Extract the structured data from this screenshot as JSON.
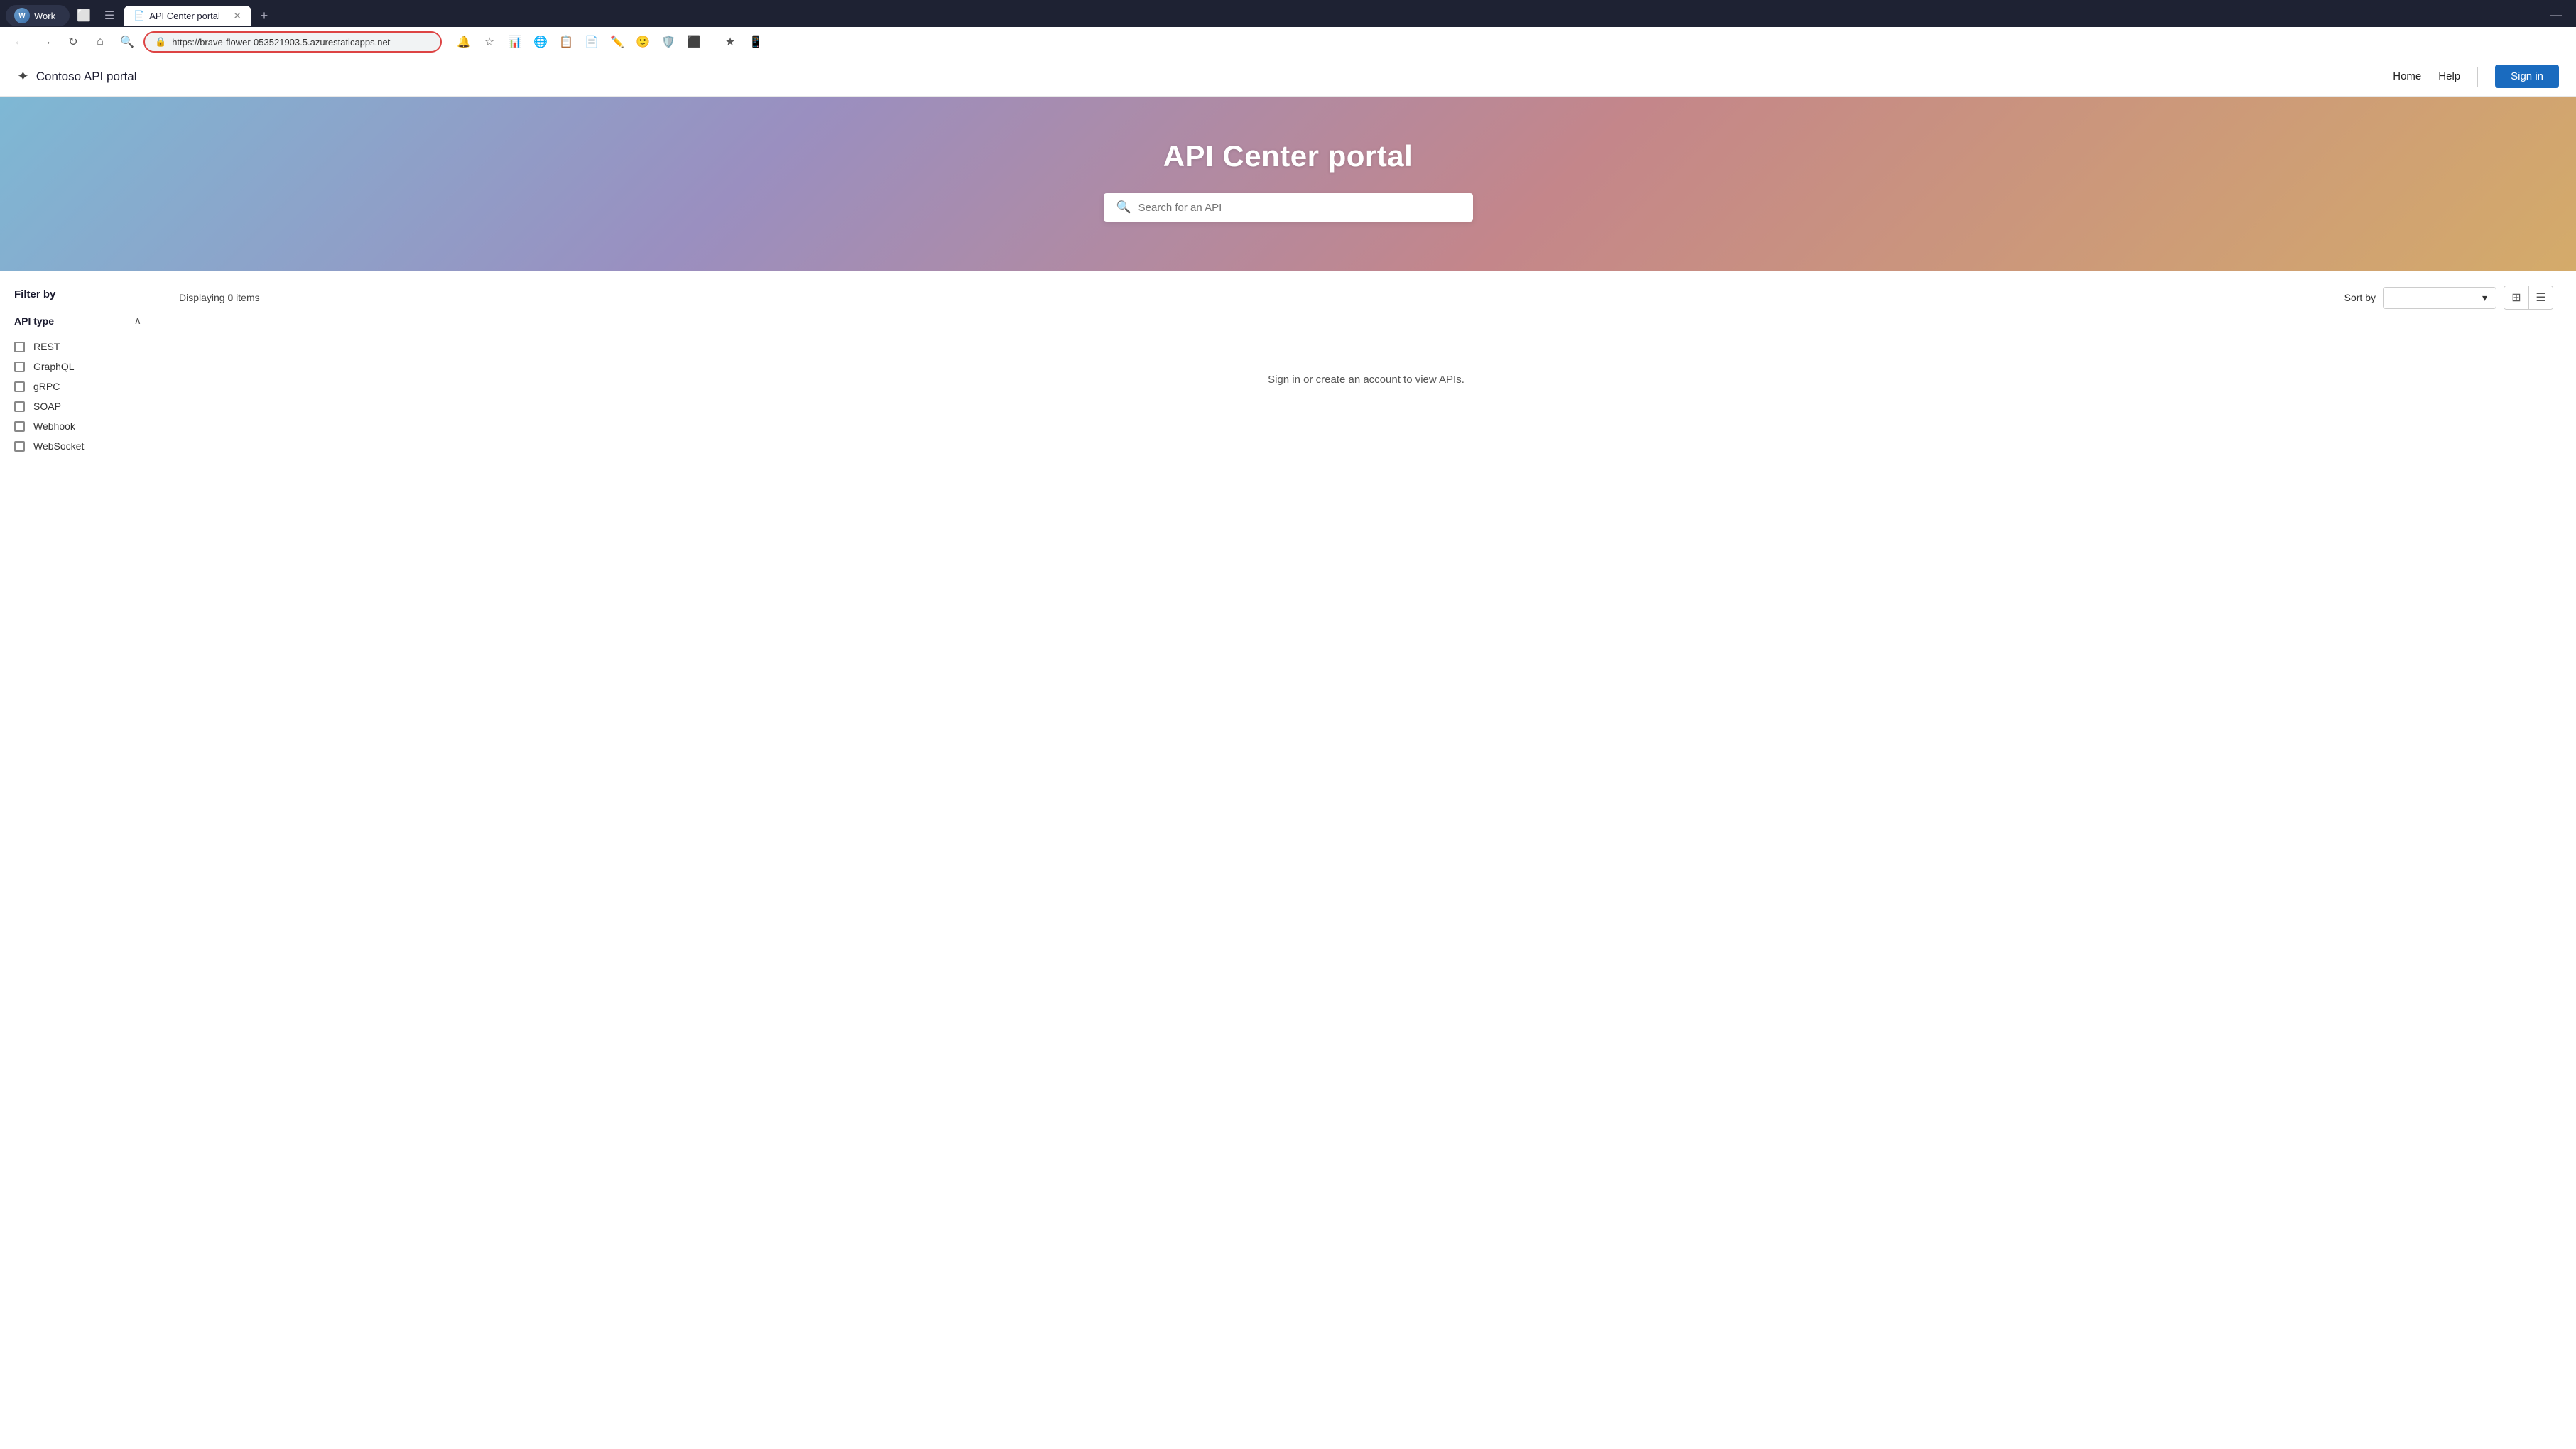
{
  "browser": {
    "tab_profile_label": "Work",
    "tab_active_label": "API Center portal",
    "tab_new_label": "+",
    "window_minimize": "—",
    "url": "https://brave-flower-053521903.5.azurestaticapps.net",
    "url_lock_icon": "🔒",
    "nav_back_icon": "←",
    "nav_forward_icon": "→",
    "nav_reload_icon": "↻",
    "nav_home_icon": "⌂",
    "nav_search_icon": "🔍",
    "toolbar_icons": [
      "🔔",
      "☆",
      "📊",
      "🌐",
      "📋",
      "📄",
      "✏",
      "🙂",
      "🛡",
      "⬜",
      "★",
      "📱"
    ],
    "toolbar_divider": true
  },
  "topnav": {
    "brand_icon": "✦",
    "brand_label": "Contoso API portal",
    "links": [
      "Home",
      "Help"
    ],
    "signin_label": "Sign in"
  },
  "hero": {
    "title": "API Center portal",
    "search_placeholder": "Search for an API"
  },
  "filter": {
    "title": "Filter by",
    "sections": [
      {
        "label": "API type",
        "expanded": true,
        "items": [
          "REST",
          "GraphQL",
          "gRPC",
          "SOAP",
          "Webhook",
          "WebSocket"
        ]
      }
    ]
  },
  "content": {
    "displaying_prefix": "Displaying ",
    "displaying_count": "0",
    "displaying_suffix": " items",
    "sort_label": "Sort by",
    "sort_placeholder": "",
    "sort_chevron": "▾",
    "view_grid_icon": "⊞",
    "view_list_icon": "☰",
    "empty_state_message": "Sign in or create an account to view APIs."
  }
}
